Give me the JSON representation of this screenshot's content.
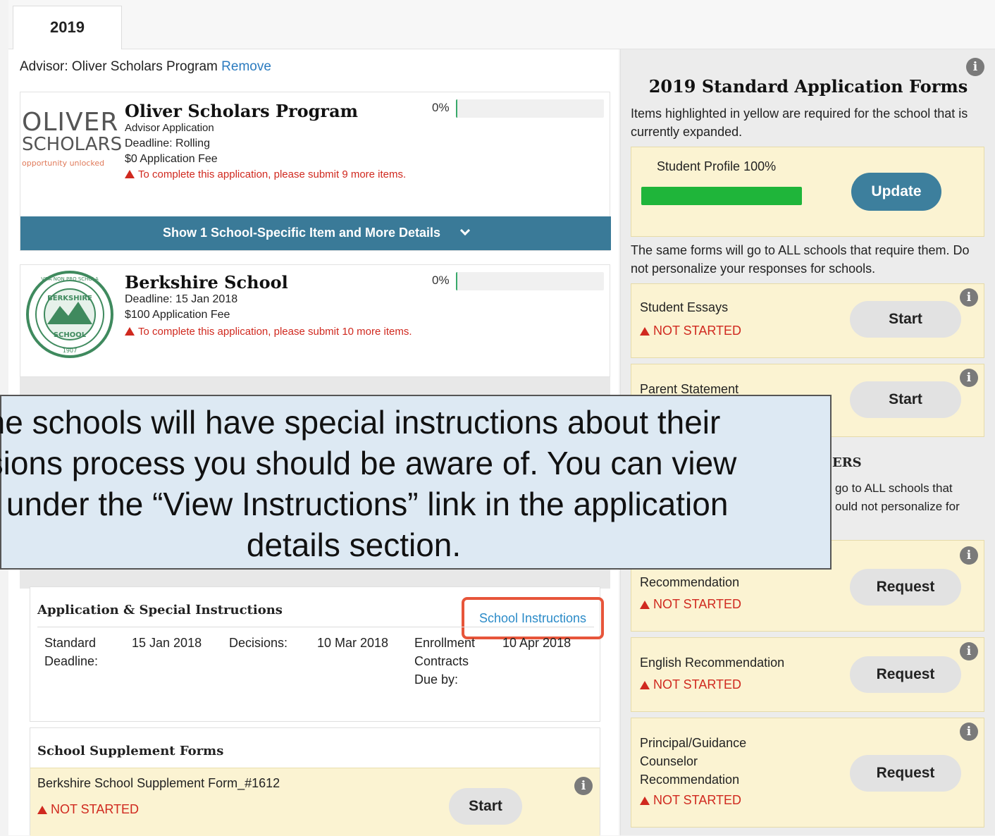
{
  "tab": "2019",
  "advisor": {
    "label": "Advisor: Oliver Scholars Program",
    "remove": "Remove"
  },
  "oliver": {
    "logo_l1": "OLIVER",
    "logo_l2": "SCHOLARS",
    "logo_l3": "opportunity unlocked",
    "title": "Oliver Scholars Program",
    "line1": "Advisor Application",
    "line2": "Deadline: Rolling",
    "line3": "$0 Application Fee",
    "warning": "To complete this application, please submit 9 more items.",
    "percent": "0%",
    "progress": 0,
    "show_bar": "Show 1 School-Specific Item and More Details"
  },
  "berkshire": {
    "seal_top": "BERKSHIRE",
    "seal_bottom": "SCHOOL",
    "seal_ring": "VITA NON PRO SCHOLA",
    "seal_year": "1907",
    "title": "Berkshire School",
    "line1": "Deadline: 15 Jan 2018",
    "line2": "$100 Application Fee",
    "warning": "To complete this application, please submit 10 more items.",
    "percent": "0%",
    "progress": 0
  },
  "app_section": {
    "title": "Application & Special Instructions",
    "link": "School Instructions",
    "std_label": "Standard Deadline:",
    "std_value": "15 Jan 2018",
    "dec_label": "Decisions:",
    "dec_value": "10 Mar 2018",
    "enr_label": "Enrollment Contracts Due by:",
    "enr_value": "10 Apr 2018"
  },
  "supp_section": {
    "title": "School Supplement Forms",
    "form": "Berkshire School Supplement Form_#1612",
    "status": "NOT STARTED",
    "button": "Start"
  },
  "right": {
    "title": "2019 Standard Application Forms",
    "intro": "Items highlighted in yellow are required for the school that is currently expanded.",
    "profile_label": "Student Profile 100%",
    "profile_progress": 1.0,
    "update": "Update",
    "same_forms": "The same forms will go to ALL schools that require them. Do not personalize your responses for schools.",
    "essays": {
      "label": "Student Essays",
      "status": "NOT STARTED",
      "button": "Start"
    },
    "parent": {
      "label": "Parent Statement",
      "button": "Start"
    },
    "partial_heading": "ERS",
    "partial_l1": "go to ALL schools that",
    "partial_l2": "ould not personalize for",
    "rec1": {
      "label": "Recommendation",
      "status": "NOT STARTED",
      "button": "Request"
    },
    "english": {
      "label": "English Recommendation",
      "status": "NOT STARTED",
      "button": "Request"
    },
    "principal": {
      "label": "Principal/Guidance Counselor Recommendation",
      "status": "NOT STARTED",
      "button": "Request"
    }
  },
  "callout": {
    "line1": "ne schools will have special instructions about their",
    "line2": "ssions process you should be aware of. You can view",
    "line3": "e under the “View Instructions” link in the application",
    "line4": "details section."
  },
  "colors": {
    "accent": "#3a7a98",
    "warning": "#d0291f",
    "highlight": "#fbf3d2",
    "progress": "#1fb53a",
    "callout_border": "#e7553a"
  }
}
